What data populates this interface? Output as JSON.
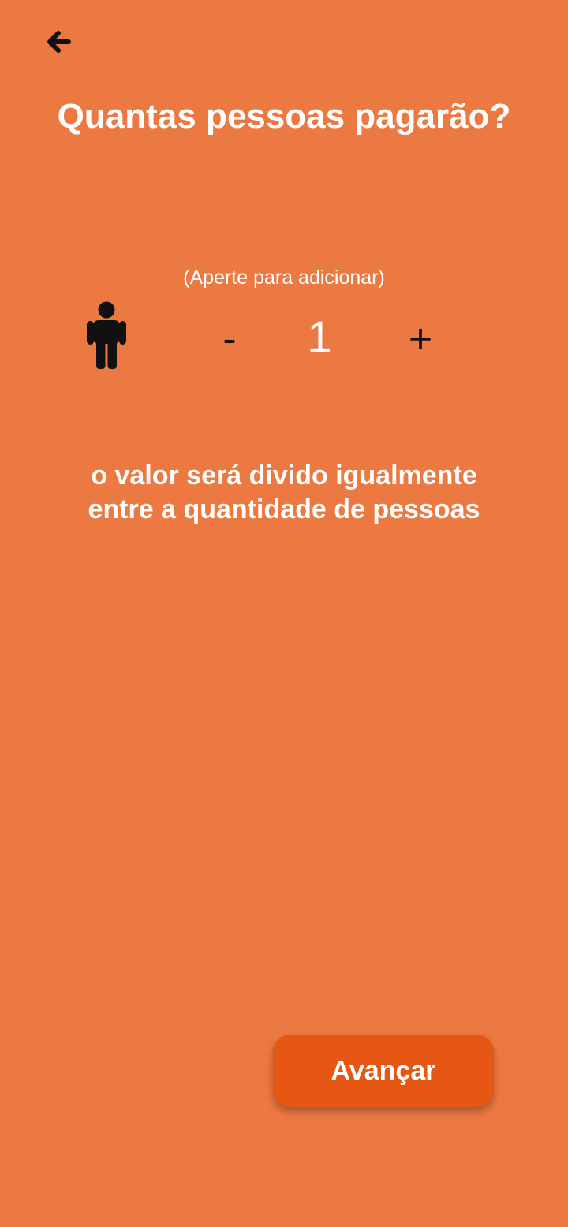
{
  "header": {
    "back_icon": "arrow-left-icon",
    "title": "Quantas pessoas pagarão?"
  },
  "counter": {
    "hint": "(Aperte para adicionar)",
    "person_icon": "person-icon",
    "minus_label": "-",
    "value": "1",
    "plus_label": "+"
  },
  "info": {
    "line1": "o valor será divido igualmente",
    "line2": "entre a quantidade de pessoas"
  },
  "footer": {
    "next_label": "Avançar"
  },
  "colors": {
    "background": "#ED7942",
    "button": "#E55713",
    "text": "#FFFFFF",
    "icon": "#111111"
  }
}
